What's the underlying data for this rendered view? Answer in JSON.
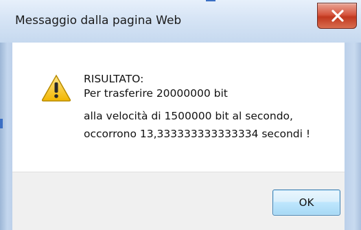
{
  "window": {
    "title": "Messaggio dalla pagina Web",
    "close_icon": "close-x-icon"
  },
  "message": {
    "icon": "warning-triangle-icon",
    "lines": [
      "RISULTATO:",
      "Per trasferire 20000000 bit",
      "alla velocità di 1500000 bit al secondo,",
      "occorrono 13,333333333333334 secondi !"
    ]
  },
  "buttons": {
    "ok_label": "OK"
  },
  "colors": {
    "close_red": "#c1381f",
    "warning_yellow": "#f5c400",
    "button_blue": "#a7d9f5"
  }
}
